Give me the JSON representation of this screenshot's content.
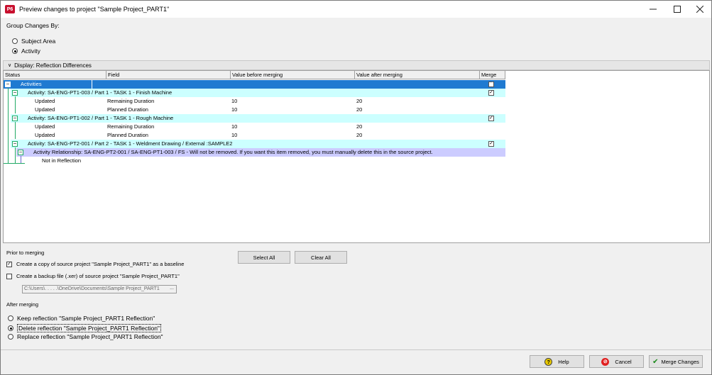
{
  "window": {
    "app_icon": "P6",
    "title": "Preview changes to project \"Sample Project_PART1\""
  },
  "group_changes": {
    "label": "Group Changes By:",
    "options": [
      "Subject Area",
      "Activity"
    ],
    "selected": "Activity"
  },
  "display_bar": {
    "label": "Display: Reflection Differences"
  },
  "table": {
    "columns": [
      "Status",
      "Field",
      "Value before merging",
      "Value after merging",
      "Merge"
    ],
    "root": {
      "label": "Activities",
      "merge": true
    },
    "groups": [
      {
        "label": "Activity: SA-ENG-PT1-003 / Part 1 - TASK 1 - Finish Machine",
        "merge": true,
        "rows": [
          {
            "status": "Updated",
            "field": "Remaining Duration",
            "before": "10",
            "after": "20"
          },
          {
            "status": "Updated",
            "field": "Planned Duration",
            "before": "10",
            "after": "20"
          }
        ]
      },
      {
        "label": "Activity: SA-ENG-PT1-002 / Part 1 - TASK 1 - Rough Machine",
        "merge": true,
        "rows": [
          {
            "status": "Updated",
            "field": "Remaining Duration",
            "before": "10",
            "after": "20"
          },
          {
            "status": "Updated",
            "field": "Planned Duration",
            "before": "10",
            "after": "20"
          }
        ]
      },
      {
        "label": "Activity: SA-ENG-PT2-001 / Part 2 - TASK 1 - Weldment Drawing / External :SAMPLE2",
        "merge": true,
        "relationship": {
          "label": "Activity Relationship: SA-ENG-PT2-001 / SA-ENG-PT1-003 / FS - Will not be removed.  If you want this item removed, you must manually delete this in the source project.",
          "status": "Not in Reflection"
        }
      }
    ]
  },
  "prior": {
    "label": "Prior to merging",
    "copy_baseline": {
      "label": "Create a copy of source project \"Sample Project_PART1\" as a baseline",
      "checked": true
    },
    "backup_file": {
      "label": "Create a backup file (.xer) of source project \"Sample Project_PART1\"",
      "checked": false
    },
    "path": "C:\\Users\\. . . . .\\OneDrive\\Documents\\Sample Project_PART1",
    "browse": "..."
  },
  "buttons": {
    "select_all": "Select All",
    "clear_all": "Clear All",
    "help": "Help",
    "cancel": "Cancel",
    "merge": "Merge Changes"
  },
  "after": {
    "label": "After merging",
    "options": [
      "Keep reflection \"Sample Project_PART1 Reflection\"",
      "Delete reflection \"Sample Project_PART1 Reflection\"",
      "Replace reflection \"Sample Project_PART1 Reflection\""
    ],
    "selected_index": 1
  },
  "colors": {
    "root_row": "#1f7ad1",
    "group_row": "#ccffff",
    "relationship_row": "#ccccff",
    "tree_line": "#22aa66"
  }
}
